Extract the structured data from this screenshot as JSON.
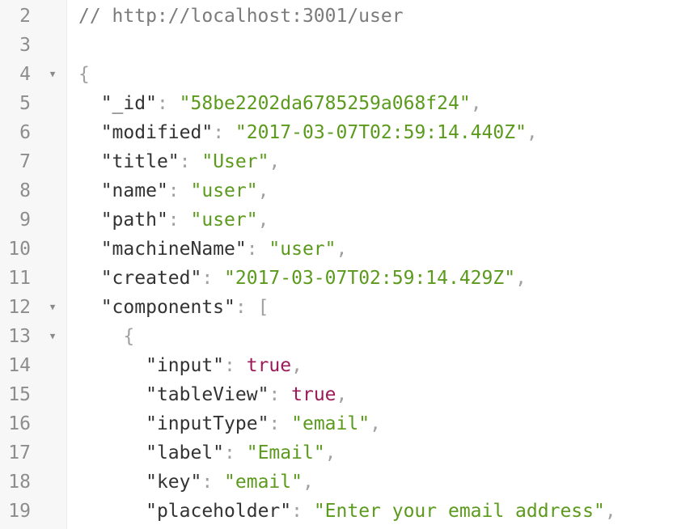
{
  "editor": {
    "colors": {
      "string": "#5b9a1c",
      "boolean": "#9b1b58",
      "comment": "#7b7b7b",
      "key": "#333333",
      "punctuation": "#a0a0a0",
      "line_number": "#8d8d8d",
      "gutter_bg": "#f7f7f7"
    },
    "fold_icon": "triangle-down",
    "lines": [
      {
        "num": "2",
        "fold": false,
        "indent": "",
        "comment": "// http://localhost:3001/user"
      },
      {
        "num": "3",
        "fold": false,
        "indent": ""
      },
      {
        "num": "4",
        "fold": true,
        "indent": "",
        "open": "{"
      },
      {
        "num": "5",
        "fold": false,
        "indent": "  ",
        "key": "\"_id\"",
        "sep": ": ",
        "value": "\"58be2202da6785259a068f24\"",
        "vtype": "str",
        "trail": ","
      },
      {
        "num": "6",
        "fold": false,
        "indent": "  ",
        "key": "\"modified\"",
        "sep": ": ",
        "value": "\"2017-03-07T02:59:14.440Z\"",
        "vtype": "str",
        "trail": ","
      },
      {
        "num": "7",
        "fold": false,
        "indent": "  ",
        "key": "\"title\"",
        "sep": ": ",
        "value": "\"User\"",
        "vtype": "str",
        "trail": ","
      },
      {
        "num": "8",
        "fold": false,
        "indent": "  ",
        "key": "\"name\"",
        "sep": ": ",
        "value": "\"user\"",
        "vtype": "str",
        "trail": ","
      },
      {
        "num": "9",
        "fold": false,
        "indent": "  ",
        "key": "\"path\"",
        "sep": ": ",
        "value": "\"user\"",
        "vtype": "str",
        "trail": ","
      },
      {
        "num": "10",
        "fold": false,
        "indent": "  ",
        "key": "\"machineName\"",
        "sep": ": ",
        "value": "\"user\"",
        "vtype": "str",
        "trail": ","
      },
      {
        "num": "11",
        "fold": false,
        "indent": "  ",
        "key": "\"created\"",
        "sep": ": ",
        "value": "\"2017-03-07T02:59:14.429Z\"",
        "vtype": "str",
        "trail": ","
      },
      {
        "num": "12",
        "fold": true,
        "indent": "  ",
        "key": "\"components\"",
        "sep": ": ",
        "open": "["
      },
      {
        "num": "13",
        "fold": true,
        "indent": "    ",
        "open": "{"
      },
      {
        "num": "14",
        "fold": false,
        "indent": "      ",
        "key": "\"input\"",
        "sep": ": ",
        "value": "true",
        "vtype": "bool",
        "trail": ","
      },
      {
        "num": "15",
        "fold": false,
        "indent": "      ",
        "key": "\"tableView\"",
        "sep": ": ",
        "value": "true",
        "vtype": "bool",
        "trail": ","
      },
      {
        "num": "16",
        "fold": false,
        "indent": "      ",
        "key": "\"inputType\"",
        "sep": ": ",
        "value": "\"email\"",
        "vtype": "str",
        "trail": ","
      },
      {
        "num": "17",
        "fold": false,
        "indent": "      ",
        "key": "\"label\"",
        "sep": ": ",
        "value": "\"Email\"",
        "vtype": "str",
        "trail": ","
      },
      {
        "num": "18",
        "fold": false,
        "indent": "      ",
        "key": "\"key\"",
        "sep": ": ",
        "value": "\"email\"",
        "vtype": "str",
        "trail": ","
      },
      {
        "num": "19",
        "fold": false,
        "indent": "      ",
        "key": "\"placeholder\"",
        "sep": ": ",
        "value": "\"Enter your email address\"",
        "vtype": "str",
        "trail": ","
      }
    ]
  }
}
